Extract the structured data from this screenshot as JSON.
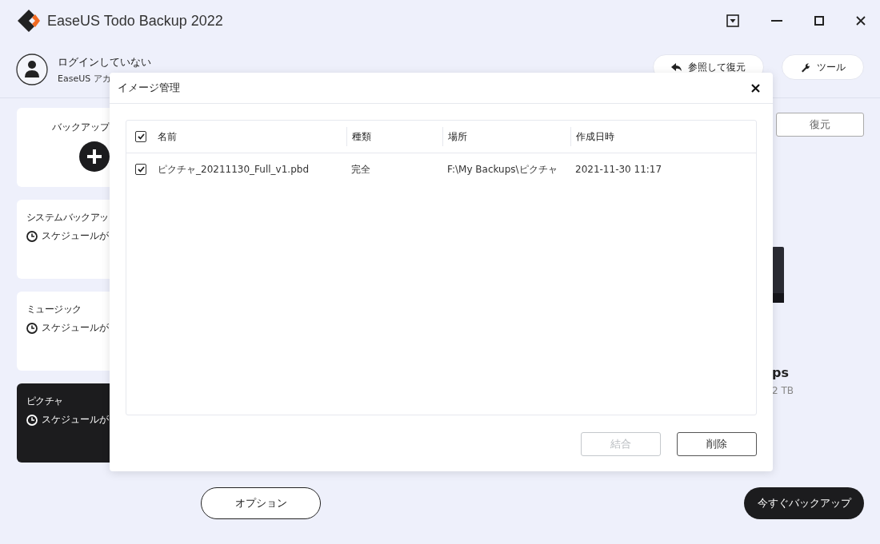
{
  "window": {
    "title": "EaseUS Todo Backup 2022"
  },
  "account": {
    "status": "ログインしていない",
    "subtitle": "EaseUS アカ"
  },
  "header_buttons": [
    {
      "kind": "restore",
      "label": "参照して復元"
    },
    {
      "kind": "tools",
      "label": "ツール"
    }
  ],
  "backup_tasks": [
    {
      "kind": "new",
      "title": "バックアップ"
    },
    {
      "kind": "task",
      "title": "システムバックアッ",
      "schedule": "スケジュールが",
      "selected": false
    },
    {
      "kind": "task",
      "title": "ミュージック",
      "schedule": "スケジュールが",
      "selected": false
    },
    {
      "kind": "task",
      "title": "ピクチャ",
      "schedule": "スケジュールが",
      "selected": true
    }
  ],
  "restore_button": "復元",
  "destination": {
    "name": "ps",
    "size": "2 TB"
  },
  "options_button": "オプション",
  "backup_now_button": "今すぐバックアップ",
  "dialog": {
    "title": "イメージ管理",
    "table": {
      "select_all_checked": true,
      "columns": [
        "名前",
        "種類",
        "場所",
        "作成日時"
      ],
      "rows": [
        {
          "checked": true,
          "cells": [
            "ピクチャ_20211130_Full_v1.pbd",
            "完全",
            "F:\\My Backups\\ピクチャ",
            "2021-11-30 11:17"
          ]
        }
      ]
    },
    "buttons": [
      {
        "label": "結合",
        "disabled": true
      },
      {
        "label": "削除",
        "disabled": false
      }
    ]
  }
}
